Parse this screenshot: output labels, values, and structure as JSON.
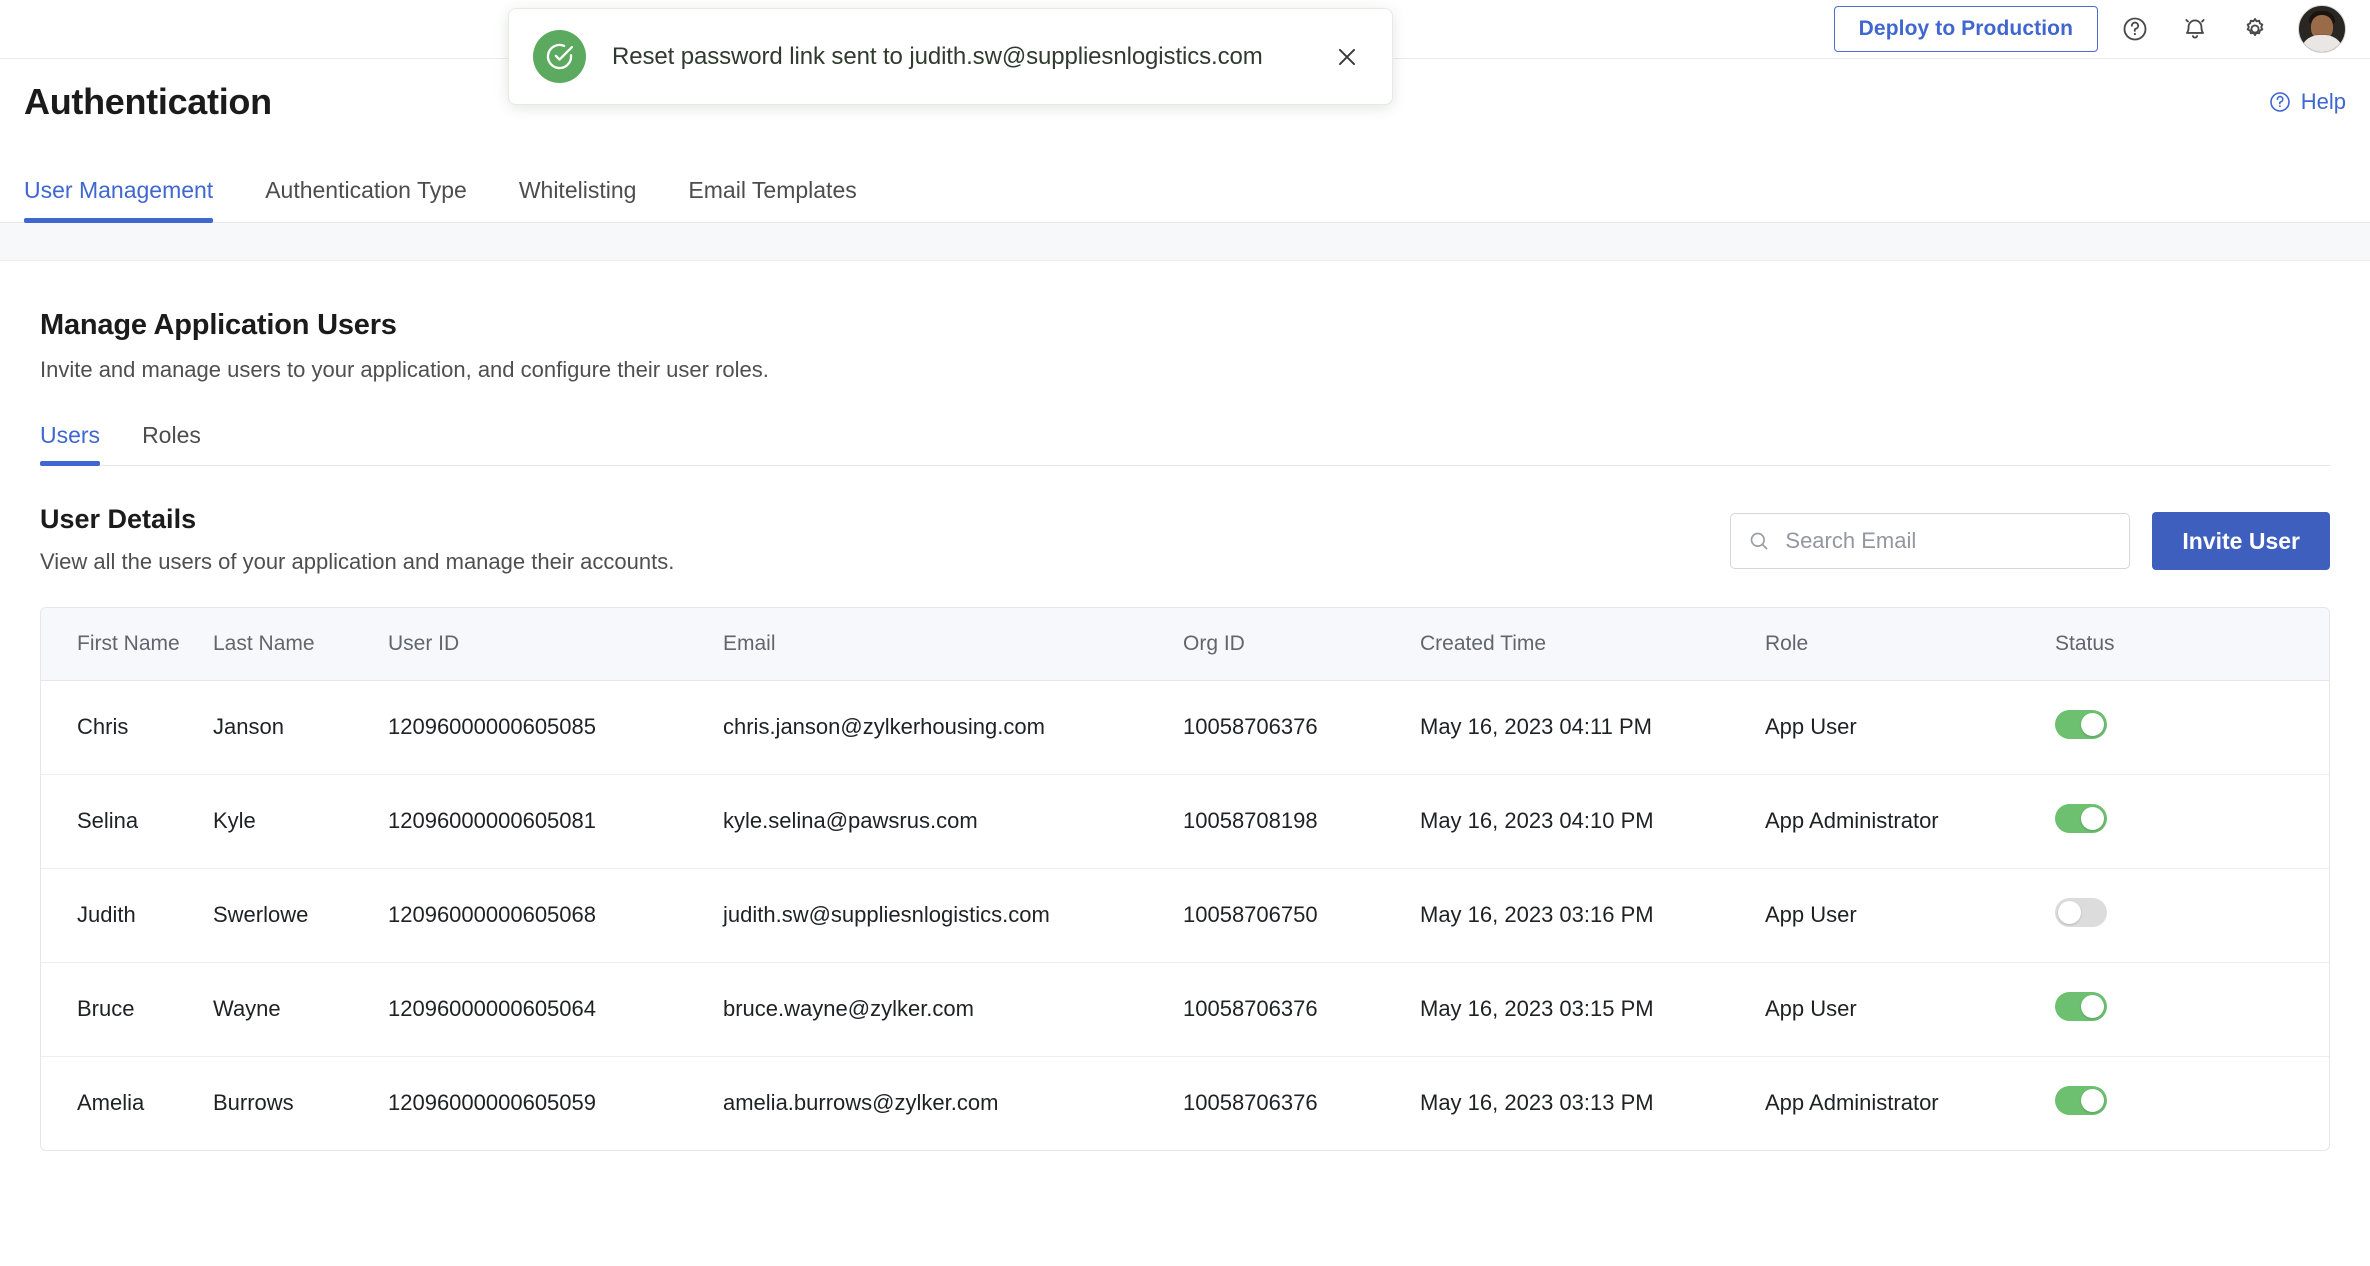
{
  "header": {
    "deploy_label": "Deploy to Production",
    "help_icon": "question-circle-icon",
    "bell_icon": "notification-bell-icon",
    "settings_icon": "gear-icon",
    "avatar": "user-avatar"
  },
  "toast": {
    "message": "Reset password link sent to judith.sw@suppliesnlogistics.com",
    "icon": "success-check-circle-icon",
    "close_label": "×",
    "accent_color": "#5caa5f"
  },
  "page": {
    "title": "Authentication",
    "help_label": "Help"
  },
  "tabs": [
    {
      "label": "User Management",
      "active": true
    },
    {
      "label": "Authentication Type",
      "active": false
    },
    {
      "label": "Whitelisting",
      "active": false
    },
    {
      "label": "Email Templates",
      "active": false
    }
  ],
  "section": {
    "title": "Manage Application Users",
    "subtitle": "Invite and manage users to your application, and configure their user roles."
  },
  "subtabs": [
    {
      "label": "Users",
      "active": true
    },
    {
      "label": "Roles",
      "active": false
    }
  ],
  "user_details": {
    "title": "User Details",
    "subtitle": "View all the users of your application and manage their accounts.",
    "search_placeholder": "Search Email",
    "search_value": "",
    "invite_label": "Invite User"
  },
  "table": {
    "columns": [
      "First Name",
      "Last Name",
      "User ID",
      "Email",
      "Org ID",
      "Created Time",
      "Role",
      "Status"
    ],
    "rows": [
      {
        "first_name": "Chris",
        "last_name": "Janson",
        "user_id": "12096000000605085",
        "email": "chris.janson@zylkerhousing.com",
        "org_id": "10058706376",
        "created_time": "May 16, 2023 04:11 PM",
        "role": "App User",
        "status": true
      },
      {
        "first_name": "Selina",
        "last_name": "Kyle",
        "user_id": "12096000000605081",
        "email": "kyle.selina@pawsrus.com",
        "org_id": "10058708198",
        "created_time": "May 16, 2023 04:10 PM",
        "role": "App Administrator",
        "status": true
      },
      {
        "first_name": "Judith",
        "last_name": "Swerlowe",
        "user_id": "12096000000605068",
        "email": "judith.sw@suppliesnlogistics.com",
        "org_id": "10058706750",
        "created_time": "May 16, 2023 03:16 PM",
        "role": "App User",
        "status": false
      },
      {
        "first_name": "Bruce",
        "last_name": "Wayne",
        "user_id": "12096000000605064",
        "email": "bruce.wayne@zylker.com",
        "org_id": "10058706376",
        "created_time": "May 16, 2023 03:15 PM",
        "role": "App User",
        "status": true
      },
      {
        "first_name": "Amelia",
        "last_name": "Burrows",
        "user_id": "12096000000605059",
        "email": "amelia.burrows@zylker.com",
        "org_id": "10058706376",
        "created_time": "May 16, 2023 03:13 PM",
        "role": "App Administrator",
        "status": true
      }
    ]
  },
  "colors": {
    "accent_blue": "#3f67cf",
    "button_blue": "#3f5fbf",
    "toggle_on": "#6cc06f",
    "toggle_off": "#dcdcdc"
  }
}
